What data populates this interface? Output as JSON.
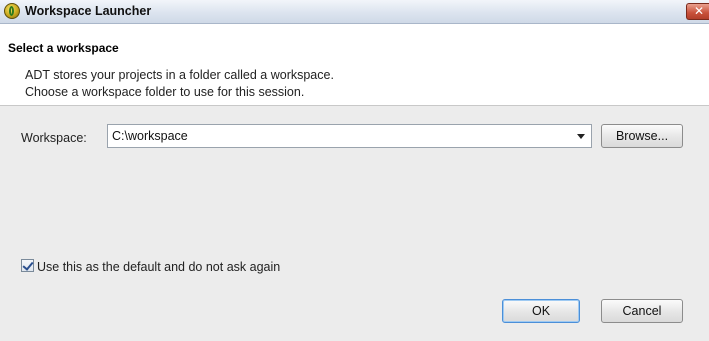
{
  "window": {
    "title": "Workspace Launcher",
    "icon": "eclipse-adt-icon",
    "close_icon": "close-icon"
  },
  "banner": {
    "title": "Select a workspace",
    "line1": "ADT stores your projects in a folder called a workspace.",
    "line2": "Choose a workspace folder to use for this session."
  },
  "workspace": {
    "label": "Workspace:",
    "value": "C:\\workspace",
    "browse_label": "Browse..."
  },
  "default_option": {
    "checked": true,
    "label": "Use this as the default and do not ask again"
  },
  "buttons": {
    "ok_label": "OK",
    "cancel_label": "Cancel"
  },
  "colors": {
    "background": "#ececec",
    "banner": "#ffffff",
    "close_button": "#c8503a",
    "default_button_border": "#4b8fd8"
  }
}
